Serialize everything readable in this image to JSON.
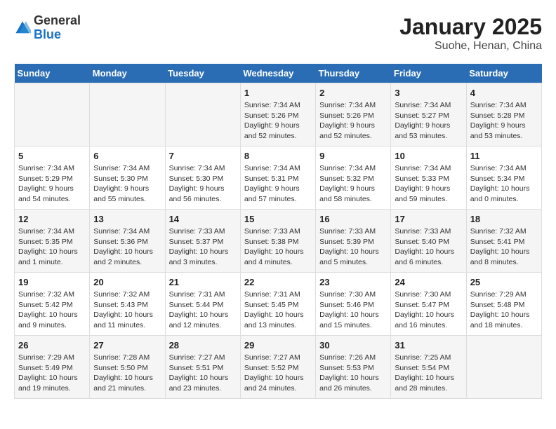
{
  "header": {
    "logo": {
      "general": "General",
      "blue": "Blue"
    },
    "title": "January 2025",
    "subtitle": "Suohe, Henan, China"
  },
  "days_of_week": [
    "Sunday",
    "Monday",
    "Tuesday",
    "Wednesday",
    "Thursday",
    "Friday",
    "Saturday"
  ],
  "weeks": [
    [
      {
        "day": null,
        "data": null
      },
      {
        "day": null,
        "data": null
      },
      {
        "day": null,
        "data": null
      },
      {
        "day": "1",
        "data": "Sunrise: 7:34 AM\nSunset: 5:26 PM\nDaylight: 9 hours and 52 minutes."
      },
      {
        "day": "2",
        "data": "Sunrise: 7:34 AM\nSunset: 5:26 PM\nDaylight: 9 hours and 52 minutes."
      },
      {
        "day": "3",
        "data": "Sunrise: 7:34 AM\nSunset: 5:27 PM\nDaylight: 9 hours and 53 minutes."
      },
      {
        "day": "4",
        "data": "Sunrise: 7:34 AM\nSunset: 5:28 PM\nDaylight: 9 hours and 53 minutes."
      }
    ],
    [
      {
        "day": "5",
        "data": "Sunrise: 7:34 AM\nSunset: 5:29 PM\nDaylight: 9 hours and 54 minutes."
      },
      {
        "day": "6",
        "data": "Sunrise: 7:34 AM\nSunset: 5:30 PM\nDaylight: 9 hours and 55 minutes."
      },
      {
        "day": "7",
        "data": "Sunrise: 7:34 AM\nSunset: 5:30 PM\nDaylight: 9 hours and 56 minutes."
      },
      {
        "day": "8",
        "data": "Sunrise: 7:34 AM\nSunset: 5:31 PM\nDaylight: 9 hours and 57 minutes."
      },
      {
        "day": "9",
        "data": "Sunrise: 7:34 AM\nSunset: 5:32 PM\nDaylight: 9 hours and 58 minutes."
      },
      {
        "day": "10",
        "data": "Sunrise: 7:34 AM\nSunset: 5:33 PM\nDaylight: 9 hours and 59 minutes."
      },
      {
        "day": "11",
        "data": "Sunrise: 7:34 AM\nSunset: 5:34 PM\nDaylight: 10 hours and 0 minutes."
      }
    ],
    [
      {
        "day": "12",
        "data": "Sunrise: 7:34 AM\nSunset: 5:35 PM\nDaylight: 10 hours and 1 minute."
      },
      {
        "day": "13",
        "data": "Sunrise: 7:34 AM\nSunset: 5:36 PM\nDaylight: 10 hours and 2 minutes."
      },
      {
        "day": "14",
        "data": "Sunrise: 7:33 AM\nSunset: 5:37 PM\nDaylight: 10 hours and 3 minutes."
      },
      {
        "day": "15",
        "data": "Sunrise: 7:33 AM\nSunset: 5:38 PM\nDaylight: 10 hours and 4 minutes."
      },
      {
        "day": "16",
        "data": "Sunrise: 7:33 AM\nSunset: 5:39 PM\nDaylight: 10 hours and 5 minutes."
      },
      {
        "day": "17",
        "data": "Sunrise: 7:33 AM\nSunset: 5:40 PM\nDaylight: 10 hours and 6 minutes."
      },
      {
        "day": "18",
        "data": "Sunrise: 7:32 AM\nSunset: 5:41 PM\nDaylight: 10 hours and 8 minutes."
      }
    ],
    [
      {
        "day": "19",
        "data": "Sunrise: 7:32 AM\nSunset: 5:42 PM\nDaylight: 10 hours and 9 minutes."
      },
      {
        "day": "20",
        "data": "Sunrise: 7:32 AM\nSunset: 5:43 PM\nDaylight: 10 hours and 11 minutes."
      },
      {
        "day": "21",
        "data": "Sunrise: 7:31 AM\nSunset: 5:44 PM\nDaylight: 10 hours and 12 minutes."
      },
      {
        "day": "22",
        "data": "Sunrise: 7:31 AM\nSunset: 5:45 PM\nDaylight: 10 hours and 13 minutes."
      },
      {
        "day": "23",
        "data": "Sunrise: 7:30 AM\nSunset: 5:46 PM\nDaylight: 10 hours and 15 minutes."
      },
      {
        "day": "24",
        "data": "Sunrise: 7:30 AM\nSunset: 5:47 PM\nDaylight: 10 hours and 16 minutes."
      },
      {
        "day": "25",
        "data": "Sunrise: 7:29 AM\nSunset: 5:48 PM\nDaylight: 10 hours and 18 minutes."
      }
    ],
    [
      {
        "day": "26",
        "data": "Sunrise: 7:29 AM\nSunset: 5:49 PM\nDaylight: 10 hours and 19 minutes."
      },
      {
        "day": "27",
        "data": "Sunrise: 7:28 AM\nSunset: 5:50 PM\nDaylight: 10 hours and 21 minutes."
      },
      {
        "day": "28",
        "data": "Sunrise: 7:27 AM\nSunset: 5:51 PM\nDaylight: 10 hours and 23 minutes."
      },
      {
        "day": "29",
        "data": "Sunrise: 7:27 AM\nSunset: 5:52 PM\nDaylight: 10 hours and 24 minutes."
      },
      {
        "day": "30",
        "data": "Sunrise: 7:26 AM\nSunset: 5:53 PM\nDaylight: 10 hours and 26 minutes."
      },
      {
        "day": "31",
        "data": "Sunrise: 7:25 AM\nSunset: 5:54 PM\nDaylight: 10 hours and 28 minutes."
      },
      {
        "day": null,
        "data": null
      }
    ]
  ]
}
